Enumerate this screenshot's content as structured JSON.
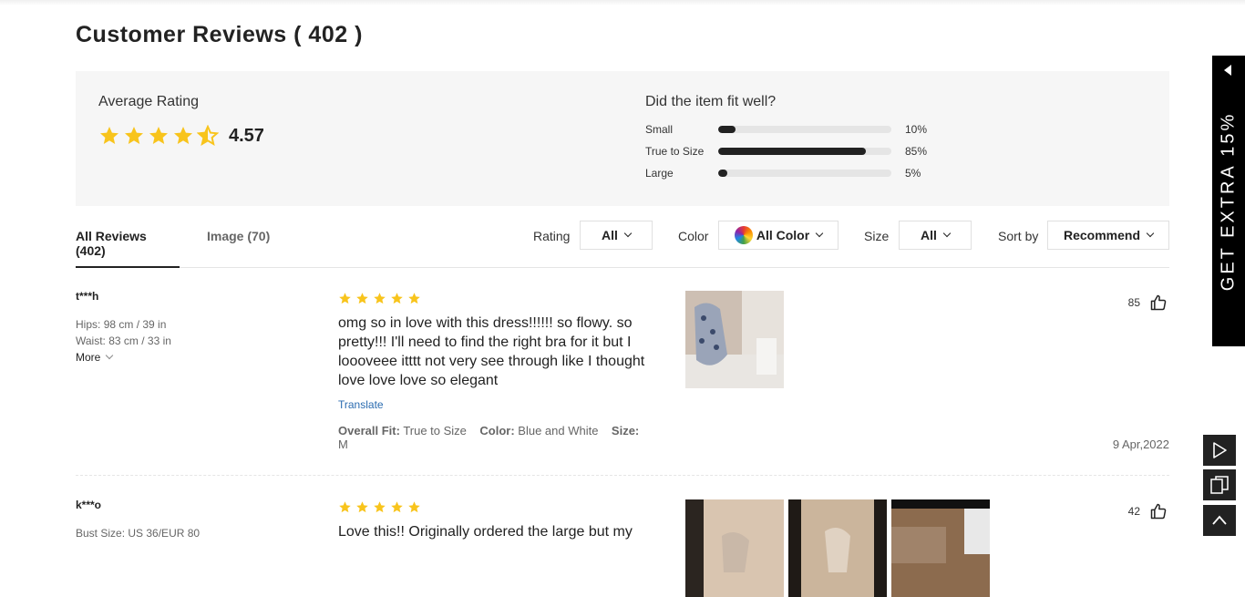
{
  "title": "Customer Reviews ( 402 )",
  "summary": {
    "avg_label": "Average Rating",
    "avg_value": "4.57",
    "rating": 4.57,
    "fit_title": "Did the item fit well?",
    "fit": [
      {
        "label": "Small",
        "pct": "10%",
        "value": 0.1
      },
      {
        "label": "True to Size",
        "pct": "85%",
        "value": 0.85
      },
      {
        "label": "Large",
        "pct": "5%",
        "value": 0.05
      }
    ]
  },
  "tabs": {
    "all": "All Reviews (402)",
    "image": "Image (70)"
  },
  "filters": {
    "rating_label": "Rating",
    "rating_value": "All",
    "color_label": "Color",
    "color_value": "All Color",
    "size_label": "Size",
    "size_value": "All",
    "sort_label": "Sort by",
    "sort_value": "Recommend"
  },
  "reviews": [
    {
      "user": "t***h",
      "attrs": [
        {
          "k": "Hips:",
          "v": "98 cm / 39 in"
        },
        {
          "k": "Waist:",
          "v": "83 cm / 33 in"
        }
      ],
      "more": "More",
      "stars": 5,
      "text": "omg so in love with this dress!!!!!! so flowy. so pretty!!! I'll need to find the right bra for it but I loooveee itttt not very see through like I thought love love love so elegant",
      "translate": "Translate",
      "meta": {
        "fit_k": "Overall Fit:",
        "fit_v": "True to Size",
        "color_k": "Color:",
        "color_v": "Blue and White",
        "size_k": "Size:",
        "size_v": "M"
      },
      "likes": "85",
      "date": "9 Apr,2022"
    },
    {
      "user": "k***o",
      "attrs": [
        {
          "k": "Bust Size:",
          "v": "US 36/EUR 80"
        }
      ],
      "stars": 5,
      "text": "Love this!! Originally ordered the large but my",
      "likes": "42"
    }
  ],
  "promo": {
    "text": "GET EXTRA 15%"
  },
  "colors": {
    "star": "#f8c41c",
    "accent": "#222222",
    "link": "#2b6cb0"
  }
}
